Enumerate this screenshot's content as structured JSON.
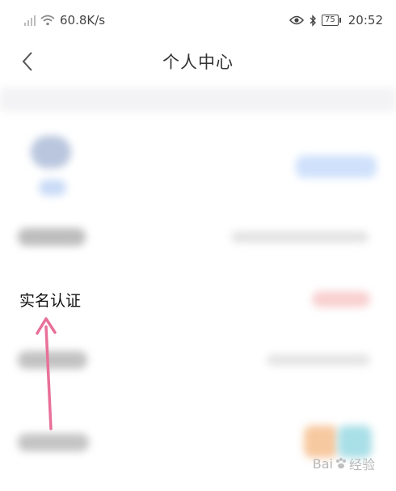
{
  "status_bar": {
    "network_speed": "60.8K/s",
    "battery": "75",
    "time": "20:52",
    "icons": [
      "signal-icon",
      "wifi-icon",
      "eye-icon",
      "bluetooth-icon",
      "battery-icon"
    ]
  },
  "header": {
    "title": "个人中心"
  },
  "list": {
    "real_name_label": "实名认证"
  },
  "annotation": {
    "arrow_color": "#e8709a"
  },
  "watermark": {
    "text": "Bai",
    "text2": "经验"
  },
  "colors": {
    "accent_blue": "#3b8ef0",
    "accent_red": "#f04a4a",
    "orange": "#f7b070",
    "teal": "#6ccad8"
  }
}
